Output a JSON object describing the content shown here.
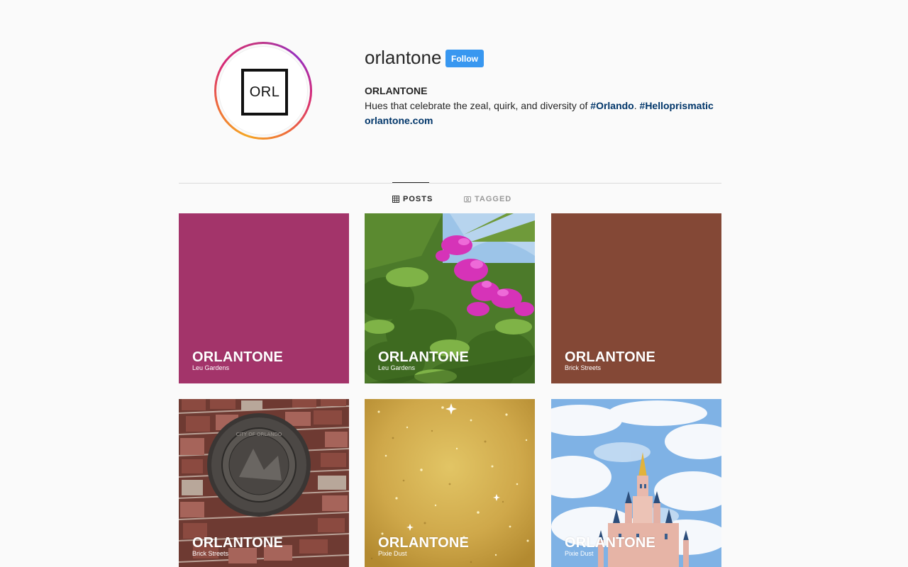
{
  "profile": {
    "username": "orlantone",
    "follow_label": "Follow",
    "full_name": "ORLANTONE",
    "bio_text": "Hues that celebrate the zeal, quirk, and diversity of ",
    "bio_tags": [
      "#Orlando",
      "#Helloprismatic"
    ],
    "bio_sep": ". ",
    "website": "orlantone.com",
    "avatar_text": "ORL"
  },
  "tabs": [
    {
      "label": "POSTS",
      "icon": "grid-icon",
      "active": true
    },
    {
      "label": "TAGGED",
      "icon": "tag-icon",
      "active": false
    }
  ],
  "posts": [
    {
      "title": "ORLANTONE",
      "subtitle": "Leu Gardens",
      "kind": "solid",
      "color": "#a3346a"
    },
    {
      "title": "ORLANTONE",
      "subtitle": "Leu Gardens",
      "kind": "photo-bougainvillea"
    },
    {
      "title": "ORLANTONE",
      "subtitle": "Brick Streets",
      "kind": "solid",
      "color": "#844836"
    },
    {
      "title": "ORLANTONE",
      "subtitle": "Brick Streets",
      "kind": "photo-bricks"
    },
    {
      "title": "ORLANTONE",
      "subtitle": "Pixie Dust",
      "kind": "photo-glitter"
    },
    {
      "title": "ORLANTONE",
      "subtitle": "Pixie Dust",
      "kind": "photo-castle"
    }
  ],
  "colors": {
    "follow_button": "#3897f0",
    "link": "#003569",
    "background": "#fafafa"
  }
}
